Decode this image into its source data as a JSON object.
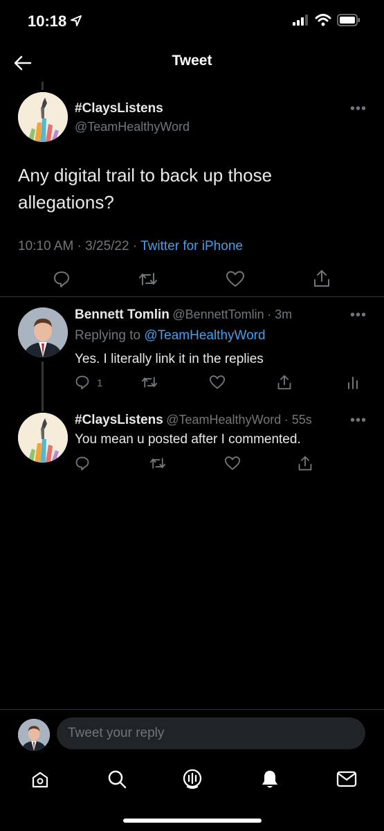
{
  "status_bar": {
    "time": "10:18"
  },
  "header": {
    "title": "Tweet"
  },
  "main_tweet": {
    "name": "#ClaysListens",
    "handle": "@TeamHealthyWord",
    "text": "Any digital trail to back up those allegations?",
    "timestamp": "10:10 AM · 3/25/22 · ",
    "source": "Twitter for iPhone"
  },
  "replies": [
    {
      "name": "Bennett Tomlin",
      "handle": "@BennettTomlin",
      "time": "· 3m",
      "replying_label": "Replying to ",
      "replying_to": "@TeamHealthyWord",
      "text": "Yes. I literally link it in the replies",
      "reply_count": "1"
    },
    {
      "name": "#ClaysListens",
      "handle": "@TeamHealthyWord",
      "time": "· 55s",
      "text": "You mean u posted after I commented."
    }
  ],
  "composer": {
    "placeholder": "Tweet your reply"
  },
  "tab_bar": [
    "home-icon",
    "search-icon",
    "spaces-icon",
    "notifications-icon",
    "messages-icon"
  ],
  "colors": {
    "background": "#000000",
    "text": "#e7e9ea",
    "muted": "#71767b",
    "link": "#4a9ee8",
    "divider": "#2f3336"
  }
}
